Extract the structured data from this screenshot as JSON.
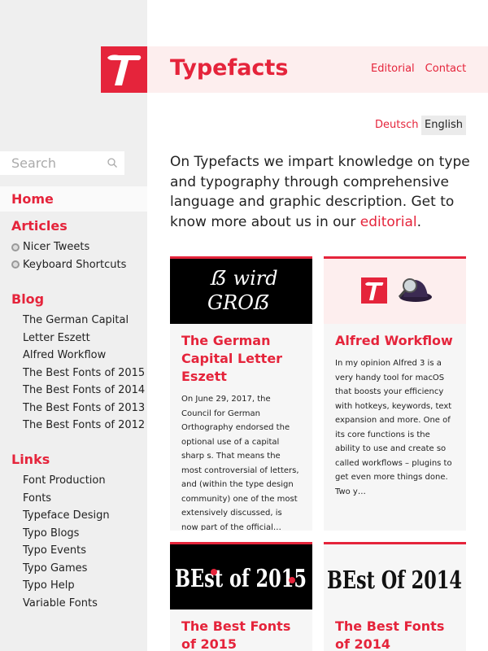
{
  "sidebar": {
    "search": {
      "placeholder": "Search"
    },
    "home": "Home",
    "articles": {
      "heading": "Articles",
      "items": [
        "Nicer Tweets",
        "Keyboard Shortcuts"
      ]
    },
    "blog": {
      "heading": "Blog",
      "items": [
        "The German Capital",
        "Letter Eszett",
        "Alfred Workflow",
        "The Best Fonts of 2015",
        "The Best Fonts of 2014",
        "The Best Fonts of 2013",
        "The Best Fonts of 2012"
      ]
    },
    "links": {
      "heading": "Links",
      "items": [
        "Font Production",
        "Fonts",
        "Typeface Design",
        "Typo Blogs",
        "Typo Events",
        "Typo Games",
        "Typo Help",
        "Variable Fonts"
      ]
    }
  },
  "header": {
    "brand": "Typefacts",
    "logo_letter": "T",
    "nav": [
      "Editorial",
      "Contact"
    ]
  },
  "language": {
    "de": "Deutsch",
    "en": "English"
  },
  "intro": {
    "text": "On Typefacts we impart knowledge on type and typography through comprehensive language and graphic description. Get to know more about us in our ",
    "link": "editorial",
    "end": "."
  },
  "cards": [
    {
      "title": "The German Capital Letter Eszett",
      "text": "On June 29, 2017, the Council for German Orthography endorsed the optional use of a capital sharp s. That means the most controversial of letters, and (within the type design community) one of the most extensively discussed, is now part of the official…",
      "image_text_top": "ẞ wird",
      "image_text_bottom": "GROẞ"
    },
    {
      "title": "Alfred Workflow",
      "text": "In my opinion Alfred 3 is a very handy tool for macOS that boosts your efficiency with hotkeys, keywords, text expansion and more. One of its core functions is the ability to use and create so called workflows – plugins to get even more things done. Two y…",
      "image_logo_letter": "T"
    },
    {
      "title": "The Best Fonts of 2015",
      "image_text": "BEst of 2015"
    },
    {
      "title": "The Best Fonts of 2014",
      "image_text": "BEst Of 2014"
    }
  ],
  "colors": {
    "accent": "#e5243b",
    "sidebar_bg": "#efefef",
    "header_bg": "#fdeeee",
    "card_bg": "#f6f6f6"
  }
}
